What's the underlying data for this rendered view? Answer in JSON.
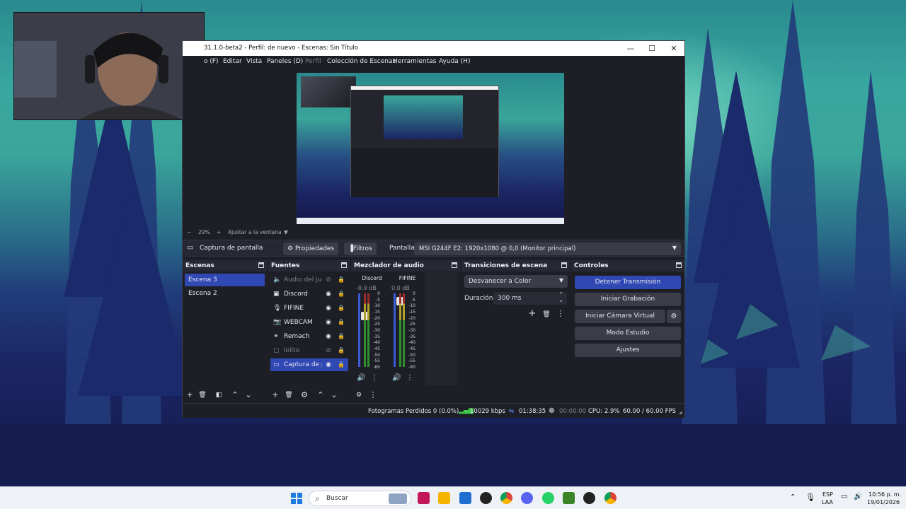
{
  "colors": {
    "accent": "#2f48b4",
    "panel": "#1e1f26",
    "dock_header": "#272833",
    "button": "#3a3c48"
  },
  "obs": {
    "title": "31.1.0-beta2 - Perfil: de nuevo - Escenas: Sin Título",
    "window_controls": [
      "minimize-icon",
      "maximize-icon",
      "close-icon"
    ],
    "menu": [
      "o (F)",
      "Editar",
      "Vista",
      "Paneles (D)",
      "Perfil",
      "Colección de Escenas",
      "Herramientas",
      "Ayuda (H)"
    ],
    "zoom": {
      "minus": "−",
      "value": "29%",
      "plus": "+",
      "fit": "Ajustar a la ventana"
    },
    "source_toolbar": {
      "source_name": "Captura de pantalla",
      "properties": "Propiedades",
      "filters": "Filtros",
      "display_label": "Pantalla",
      "display_value": "MSI G244F E2: 1920x1080 @ 0,0 (Monitor principal)"
    },
    "scenes": {
      "title": "Escenas",
      "items": [
        "Escena 3",
        "Escena 2"
      ],
      "active": 0
    },
    "sources": {
      "title": "Fuentes",
      "items": [
        {
          "label": "Audio del juego",
          "icon": "speaker-icon",
          "visible": false,
          "dimmed": true
        },
        {
          "label": "Discord",
          "icon": "window-capture-icon",
          "visible": true,
          "dimmed": false
        },
        {
          "label": "FIFINE",
          "icon": "microphone-icon",
          "visible": true,
          "dimmed": false
        },
        {
          "label": "WEBCAM",
          "icon": "camera-icon",
          "visible": true,
          "dimmed": false
        },
        {
          "label": "Remach",
          "icon": "link-icon",
          "visible": true,
          "dimmed": false
        },
        {
          "label": "lolito",
          "icon": "image-icon",
          "visible": false,
          "dimmed": true
        },
        {
          "label": "Captura de pantalla",
          "icon": "monitor-icon",
          "visible": true,
          "dimmed": false
        }
      ],
      "active": 6
    },
    "mixer": {
      "title": "Mezclador de audio",
      "channels": [
        {
          "name": "Discord",
          "db": "-8.9 dB",
          "level": 0.72
        },
        {
          "name": "FIFINE",
          "db": "0.0 dB",
          "level": 0.95
        }
      ],
      "scale": [
        "0",
        "-5",
        "-10",
        "-15",
        "-20",
        "-25",
        "-30",
        "-35",
        "-40",
        "-45",
        "-50",
        "-55",
        "-60"
      ]
    },
    "transitions": {
      "title": "Transiciones de escena",
      "selected": "Desvanecer a Color",
      "duration_label": "Duración",
      "duration_value": "300 ms"
    },
    "controls": {
      "title": "Controles",
      "buttons": [
        "Detener Transmisión",
        "Iniciar Grabación",
        "Iniciar Cámara Virtual",
        "Modo Estudio",
        "Ajustes"
      ]
    },
    "status": {
      "dropped": "Fotogramas Perdidos 0 (0.0%)",
      "bitrate": "10029 kbps",
      "stream_time": "01:38:35",
      "rec_time": "00:00:00",
      "cpu": "CPU: 2.9%",
      "fps": "60.00 / 60.00 FPS"
    }
  },
  "taskbar": {
    "search_placeholder": "Buscar",
    "language": "ESP",
    "layout": "LAA",
    "time": "10:56 p. m.",
    "date": "19/01/2026"
  }
}
